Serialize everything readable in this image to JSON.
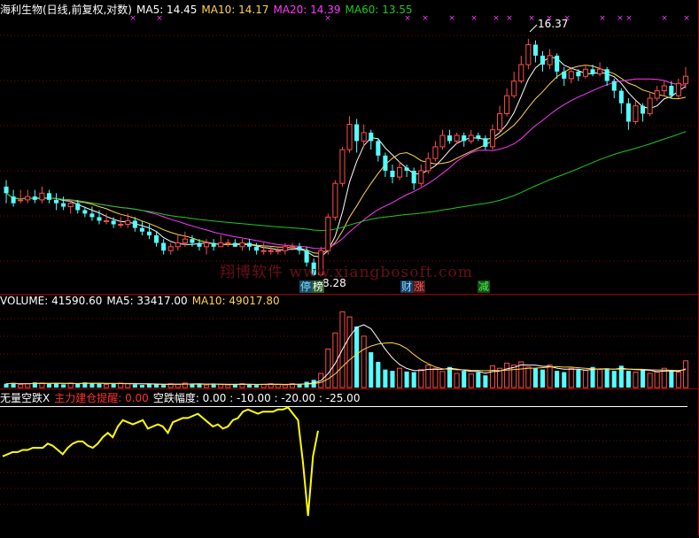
{
  "colors": {
    "up": "#ff4d4d",
    "down": "#54ffff",
    "ma5": "#ffffff",
    "ma10": "#ffd54a",
    "ma20": "#ff37ff",
    "ma60": "#1ec91e",
    "osc": "#ffff00",
    "grid": "#8a0000",
    "divider": "#a00000"
  },
  "price_panel": {
    "title": "海利生物(日线,前复权,对数)",
    "ma5_label": "MA5: 14.45",
    "ma10_label": "MA10: 14.17",
    "ma20_label": "MA20: 14.39",
    "ma60_label": "MA60: 13.55",
    "high_label": "16.37",
    "low_label": "8.28",
    "watermark": "翔博软件 www.xiangbosoft.com",
    "tags": [
      {
        "text": "停",
        "color": "#7fdcff"
      },
      {
        "text": "榜",
        "color": "#ffffff"
      },
      {
        "text": "财",
        "color": "#7fdcff"
      },
      {
        "text": "涨",
        "color": "#ff5a5a"
      },
      {
        "text": "减",
        "color": "#3fff3f"
      }
    ]
  },
  "volume_panel": {
    "volume_label": "VOLUME: 41590.60",
    "ma5_label": "MA5: 33417.00",
    "ma10_label": "MA10: 49017.80"
  },
  "indicator_panel": {
    "name_label": "无量空跌X",
    "signal_label": "主力建仓提醒: 0.00",
    "range_label": "空跌幅度: 0.00 : -10.00 : -20.00 : -25.00"
  },
  "chart_data": [
    {
      "type": "candlestick",
      "title": "海利生物(日线,前复权,对数)",
      "scale": "log",
      "ylim": [
        7.9,
        17.4
      ],
      "marked_high": 16.37,
      "marked_low": 8.28,
      "candles": [
        [
          10.7,
          10.5,
          10.9,
          10.2
        ],
        [
          10.4,
          10.2,
          10.6,
          10.1
        ],
        [
          10.3,
          10.3,
          10.6,
          10.2
        ],
        [
          10.3,
          10.4,
          10.6,
          10.2
        ],
        [
          10.4,
          10.3,
          10.6,
          10.2
        ],
        [
          10.3,
          10.5,
          10.7,
          10.2
        ],
        [
          10.5,
          10.3,
          10.6,
          10.2
        ],
        [
          10.3,
          10.2,
          10.5,
          10.0
        ],
        [
          10.2,
          10.1,
          10.4,
          10.0
        ],
        [
          10.1,
          10.2,
          10.3,
          9.9
        ],
        [
          10.2,
          10.0,
          10.3,
          9.9
        ],
        [
          10.0,
          9.9,
          10.1,
          9.8
        ],
        [
          9.9,
          9.8,
          10.1,
          9.7
        ],
        [
          9.8,
          9.7,
          10.0,
          9.6
        ],
        [
          9.7,
          9.7,
          9.9,
          9.6
        ],
        [
          9.7,
          9.6,
          9.8,
          9.5
        ],
        [
          9.6,
          9.6,
          9.8,
          9.5
        ],
        [
          9.6,
          9.7,
          9.9,
          9.5
        ],
        [
          9.7,
          9.5,
          9.8,
          9.4
        ],
        [
          9.5,
          9.4,
          9.7,
          9.3
        ],
        [
          9.4,
          9.3,
          9.6,
          9.2
        ],
        [
          9.3,
          9.1,
          9.4,
          9.0
        ],
        [
          9.1,
          8.9,
          9.2,
          8.8
        ],
        [
          8.9,
          9.0,
          9.1,
          8.8
        ],
        [
          9.0,
          9.1,
          9.3,
          8.9
        ],
        [
          9.1,
          9.2,
          9.4,
          9.0
        ],
        [
          9.2,
          9.1,
          9.3,
          9.0
        ],
        [
          9.1,
          9.0,
          9.2,
          8.9
        ],
        [
          9.0,
          9.1,
          9.2,
          8.8
        ],
        [
          9.1,
          9.0,
          9.2,
          8.9
        ],
        [
          9.0,
          9.1,
          9.3,
          9.0
        ],
        [
          9.1,
          9.1,
          9.2,
          9.0
        ],
        [
          9.1,
          9.0,
          9.2,
          9.0
        ],
        [
          9.0,
          9.1,
          9.2,
          8.9
        ],
        [
          9.1,
          9.0,
          9.2,
          8.9
        ],
        [
          9.0,
          8.9,
          9.1,
          8.8
        ],
        [
          8.9,
          8.9,
          9.1,
          8.8
        ],
        [
          8.9,
          8.9,
          9.0,
          8.8
        ],
        [
          8.9,
          8.9,
          9.0,
          8.8
        ],
        [
          8.9,
          9.0,
          9.1,
          8.8
        ],
        [
          9.0,
          9.0,
          9.1,
          8.9
        ],
        [
          9.0,
          8.9,
          9.1,
          8.8
        ],
        [
          8.9,
          8.6,
          9.0,
          8.5
        ],
        [
          8.6,
          8.3,
          8.7,
          8.28
        ],
        [
          8.3,
          8.9,
          9.0,
          8.28
        ],
        [
          8.9,
          9.8,
          9.9,
          8.8
        ],
        [
          9.8,
          10.8,
          10.9,
          9.7
        ],
        [
          10.8,
          11.9,
          12.0,
          10.7
        ],
        [
          11.9,
          12.8,
          13.1,
          11.8
        ],
        [
          12.8,
          12.2,
          13.0,
          11.8
        ],
        [
          12.2,
          12.5,
          12.8,
          12.0
        ],
        [
          12.5,
          12.2,
          12.6,
          11.9
        ],
        [
          12.2,
          11.7,
          12.3,
          11.5
        ],
        [
          11.7,
          11.2,
          11.8,
          11.0
        ],
        [
          11.2,
          11.0,
          11.4,
          10.8
        ],
        [
          11.0,
          11.3,
          11.5,
          10.9
        ],
        [
          11.3,
          11.2,
          11.4,
          11.0
        ],
        [
          11.2,
          10.8,
          11.3,
          10.6
        ],
        [
          10.8,
          11.2,
          11.4,
          10.7
        ],
        [
          11.2,
          11.6,
          11.8,
          11.1
        ],
        [
          11.6,
          12.0,
          12.2,
          11.5
        ],
        [
          12.0,
          12.4,
          12.6,
          11.9
        ],
        [
          12.4,
          12.2,
          12.6,
          12.1
        ],
        [
          12.2,
          12.4,
          12.5,
          12.1
        ],
        [
          12.4,
          12.2,
          12.5,
          12.0
        ],
        [
          12.2,
          12.4,
          12.6,
          12.1
        ],
        [
          12.4,
          12.3,
          12.5,
          12.2
        ],
        [
          12.3,
          12.0,
          12.4,
          11.9
        ],
        [
          12.0,
          12.6,
          12.8,
          11.9
        ],
        [
          12.6,
          13.2,
          13.5,
          12.5
        ],
        [
          13.2,
          13.9,
          14.2,
          13.1
        ],
        [
          13.9,
          14.5,
          14.9,
          13.8
        ],
        [
          14.5,
          15.2,
          15.6,
          14.4
        ],
        [
          15.2,
          16.1,
          16.37,
          15.0
        ],
        [
          16.1,
          15.6,
          16.3,
          15.3
        ],
        [
          15.6,
          15.2,
          15.8,
          14.9
        ],
        [
          15.2,
          15.6,
          15.9,
          15.0
        ],
        [
          15.6,
          14.9,
          15.7,
          14.6
        ],
        [
          14.9,
          14.6,
          15.1,
          14.3
        ],
        [
          14.6,
          14.9,
          15.1,
          14.4
        ],
        [
          14.9,
          14.7,
          15.0,
          14.5
        ],
        [
          14.7,
          15.0,
          15.2,
          14.6
        ],
        [
          15.0,
          14.8,
          15.2,
          14.7
        ],
        [
          14.8,
          15.0,
          15.3,
          14.7
        ],
        [
          15.0,
          14.5,
          15.1,
          14.3
        ],
        [
          14.5,
          14.1,
          14.6,
          13.8
        ],
        [
          14.1,
          13.6,
          14.2,
          13.2
        ],
        [
          13.6,
          12.9,
          13.8,
          12.6
        ],
        [
          12.9,
          13.5,
          13.7,
          12.8
        ],
        [
          13.5,
          13.2,
          13.6,
          12.9
        ],
        [
          13.2,
          13.8,
          14.0,
          13.1
        ],
        [
          13.8,
          14.1,
          14.3,
          13.7
        ],
        [
          14.1,
          14.3,
          14.5,
          13.9
        ],
        [
          14.3,
          13.9,
          14.5,
          13.8
        ],
        [
          13.9,
          14.4,
          14.6,
          13.8
        ],
        [
          14.4,
          14.7,
          15.1,
          14.2
        ]
      ],
      "ma_periods": [
        5,
        10,
        20,
        60
      ],
      "ma_last": {
        "MA5": 14.45,
        "MA10": 14.17,
        "MA20": 14.39,
        "MA60": 13.55
      }
    },
    {
      "type": "bar",
      "title": "VOLUME",
      "last_value": 41590.6,
      "ma_last": {
        "MA5": 33417.0,
        "MA10": 49017.8
      },
      "values": [
        6000,
        7000,
        5000,
        6000,
        8000,
        7000,
        6000,
        7000,
        5000,
        7000,
        6000,
        8000,
        7000,
        6000,
        5000,
        6000,
        7000,
        6000,
        5000,
        4000,
        6000,
        5000,
        4000,
        6000,
        5000,
        7000,
        6000,
        5000,
        4000,
        6000,
        5000,
        4000,
        5000,
        6000,
        5000,
        4000,
        5000,
        6000,
        5000,
        4000,
        6000,
        5000,
        9000,
        12000,
        22000,
        60000,
        85000,
        118000,
        110000,
        95000,
        80000,
        55000,
        40000,
        28000,
        26000,
        30000,
        25000,
        24000,
        28000,
        35000,
        30000,
        25000,
        32000,
        22000,
        26000,
        21000,
        24000,
        19000,
        34000,
        30000,
        38000,
        35000,
        40000,
        32000,
        30000,
        28000,
        35000,
        26000,
        24000,
        30000,
        28000,
        27000,
        32000,
        28000,
        30000,
        26000,
        34000,
        26000,
        24000,
        28000,
        22000,
        24000,
        30000,
        26000,
        24000,
        41590.6
      ]
    },
    {
      "type": "line",
      "title": "无量空跌X",
      "series": [
        {
          "name": "无量空跌X",
          "values": [
            -12,
            -11,
            -10,
            -10,
            -9,
            -9,
            -8,
            -8,
            -8,
            -6,
            -7,
            -9,
            -11,
            -8,
            -6,
            -5,
            -5,
            -7,
            -8,
            -6,
            -3,
            -1,
            -3,
            2,
            5,
            4,
            3,
            4,
            5,
            1,
            2,
            3,
            2,
            -1,
            4,
            5,
            6,
            6,
            7,
            8,
            6,
            4,
            2,
            3,
            1,
            2,
            5,
            6,
            9,
            10,
            9,
            8,
            9,
            9,
            9,
            10,
            10,
            11,
            8,
            5,
            -15,
            -40,
            -12,
            0
          ]
        }
      ],
      "ylim": [
        -45,
        12
      ]
    }
  ]
}
